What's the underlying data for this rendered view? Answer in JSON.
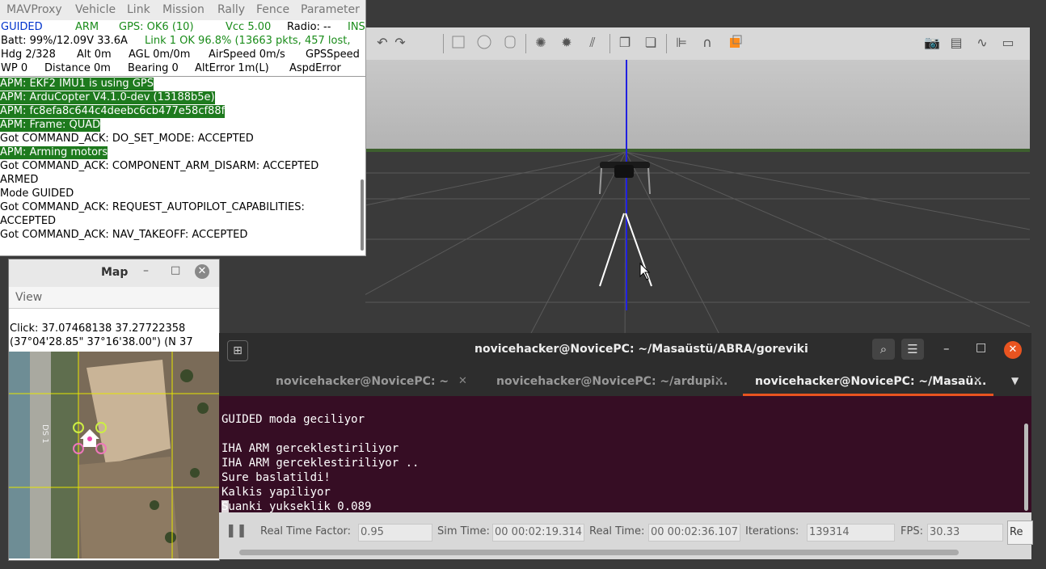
{
  "mavproxy": {
    "menu": [
      "MAVProxy",
      "Vehicle",
      "Link",
      "Mission",
      "Rally",
      "Fence",
      "Parameter"
    ],
    "status": {
      "mode": "GUIDED",
      "arm": "ARM",
      "gps": "GPS: OK6 (10)",
      "vcc": "Vcc 5.00",
      "radio": "Radio: --",
      "ins": "INS",
      "batt": "Batt: 99%/12.09V 33.6A",
      "link": "Link 1 OK 96.8% (13663 pkts, 457 lost,",
      "hdg": "Hdg  2/328",
      "alt": "Alt 0m",
      "agl": "AGL 0m/0m",
      "airspeed": "AirSpeed 0m/s",
      "gpsspeed": "GPSSpeed",
      "wp": "WP 0",
      "distance": "Distance 0m",
      "bearing": "Bearing 0",
      "alterror": "AltError 1m(L)",
      "aspderror": "AspdError"
    },
    "log": [
      "APM: EKF2 IMU1 is using GPS",
      "APM: ArduCopter V4.1.0-dev (13188b5e)",
      "APM: fc8efa8c644c4deebc6cb477e58cf88f",
      "APM: Frame: QUAD",
      "Got COMMAND_ACK: DO_SET_MODE: ACCEPTED",
      "APM: Arming motors",
      "Got COMMAND_ACK: COMPONENT_ARM_DISARM: ACCEPTED",
      "ARMED",
      "Mode GUIDED",
      "Got COMMAND_ACK: REQUEST_AUTOPILOT_CAPABILITIES:",
      "ACCEPTED",
      "Got COMMAND_ACK: NAV_TAKEOFF: ACCEPTED"
    ]
  },
  "map": {
    "title": "Map",
    "menu_view": "View",
    "click_line1": "Click: 37.07468138 37.27722358",
    "click_line2": "(37°04'28.85\" 37°16'38.00\") (N 37",
    "road_label": "DS 1"
  },
  "terminal": {
    "title": "novicehacker@NovicePC: ~/Masaüstü/ABRA/goreviki",
    "tabs": [
      "novicehacker@NovicePC: ~",
      "novicehacker@NovicePC: ~/ardupi...",
      "novicehacker@NovicePC: ~/Masaü..."
    ],
    "lines": [
      "GUIDED moda geciliyor",
      "",
      "IHA ARM gerceklestiriliyor",
      "IHA ARM gerceklestiriliyor ..",
      "Sure baslatildi!",
      "Kalkis yapiliyor",
      "Suanki yukseklik 0.089"
    ]
  },
  "gazebo": {
    "accent_color": "#ff8c1a",
    "sim": {
      "rtf_label": "Real Time Factor:",
      "rtf_value": "0.95",
      "simtime_label": "Sim Time:",
      "simtime_value": "00 00:02:19.314",
      "realtime_label": "Real Time:",
      "realtime_value": "00 00:02:36.107",
      "iterations_label": "Iterations:",
      "iterations_value": "139314",
      "fps_label": "FPS:",
      "fps_value": "30.33",
      "reset_label": "Re"
    }
  },
  "colors": {
    "status_blue": "#0033cc",
    "status_green": "#1a8c1a",
    "log_highlight": "#1e7a1e",
    "terminal_bg": "#360d24",
    "close_orange": "#e95420"
  }
}
